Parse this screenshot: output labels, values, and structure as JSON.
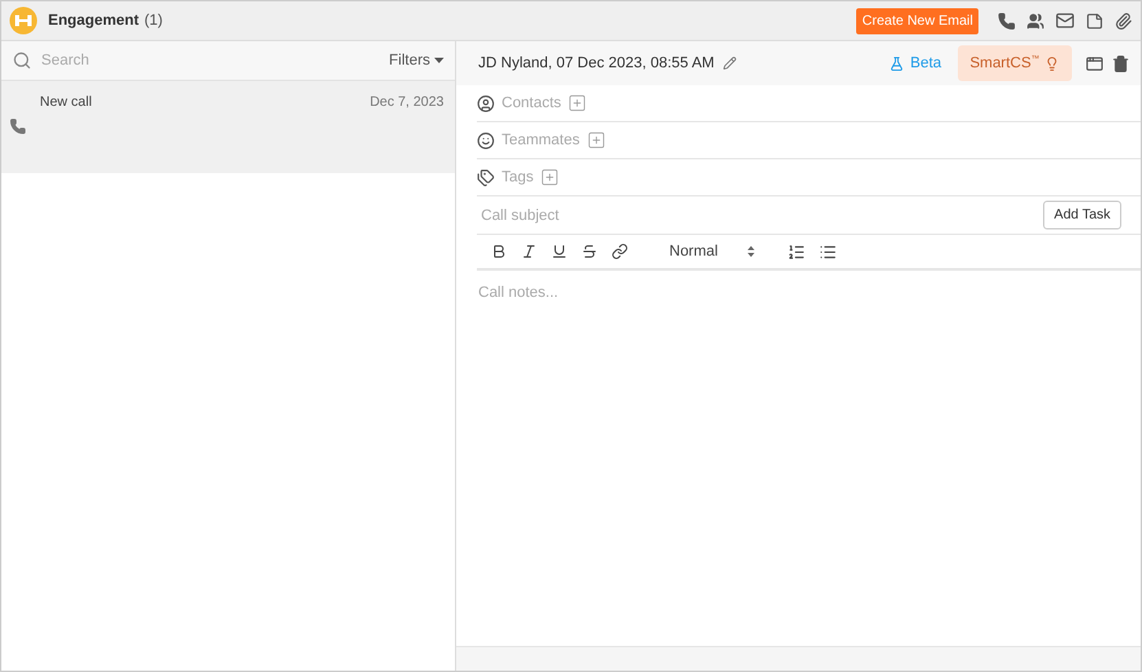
{
  "header": {
    "title": "Engagement",
    "count": "(1)",
    "create_button": "Create New Email"
  },
  "list": {
    "search_placeholder": "Search",
    "filters": "Filters",
    "items": [
      {
        "title": "New call",
        "date": "Dec 7, 2023",
        "selected": true
      }
    ]
  },
  "detail": {
    "title": "JD Nyland, 07 Dec 2023, 08:55 AM",
    "beta": "Beta",
    "smartcs": {
      "label": "SmartCS$^{™}$",
      "disabled": true
    },
    "fields": [
      {
        "kind": "contacts",
        "label": "Contacts"
      },
      {
        "kind": "teammates",
        "label": "Teammates"
      },
      {
        "kind": "tags",
        "label": "Tags"
      }
    ],
    "subject_placeholder": "Call subject",
    "add_task": "Add Task",
    "text_style": "Normal",
    "notes_placeholder": "Call notes..."
  }
}
